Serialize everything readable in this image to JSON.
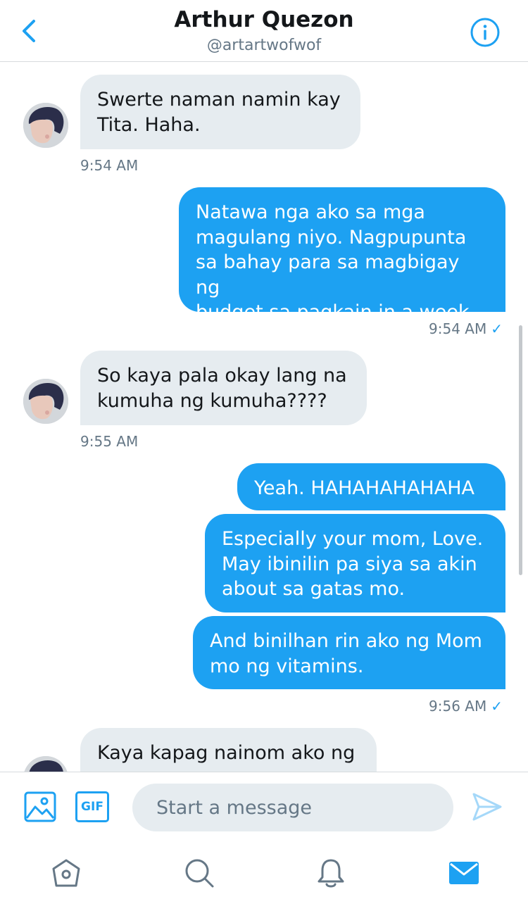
{
  "header": {
    "title": "Arthur Quezon",
    "handle": "@artartwofwof",
    "back_icon": "chevron-left-icon",
    "info_icon": "info-icon"
  },
  "colors": {
    "accent": "#1da1f2",
    "incoming_bubble": "#e6ecf0",
    "secondary_text": "#657786"
  },
  "messages": [
    {
      "direction": "incoming",
      "lines": [
        "Swerte naman namin kay",
        "Tita. Haha."
      ],
      "time": "9:54 AM"
    },
    {
      "direction": "outgoing",
      "lines": [
        "Natawa nga ako sa mga",
        "magulang niyo. Nagpupunta",
        "sa bahay para sa magbigay ng",
        "budget sa pagkain in a week."
      ],
      "time": "9:54 AM",
      "status": "✓"
    },
    {
      "direction": "incoming",
      "lines": [
        "So kaya pala okay lang na",
        "kumuha ng kumuha????"
      ],
      "time": "9:55 AM"
    },
    {
      "direction": "outgoing",
      "lines": [
        "Yeah. HAHAHAHAHAHA"
      ]
    },
    {
      "direction": "outgoing",
      "lines": [
        "Especially your mom, Love.",
        "May ibinilin pa siya sa akin",
        "about sa gatas mo."
      ]
    },
    {
      "direction": "outgoing",
      "lines": [
        "And binilhan rin ako ng Mom",
        "mo ng vitamins."
      ],
      "time": "9:56 AM",
      "status": "✓"
    },
    {
      "direction": "incoming",
      "lines": [
        "Kaya kapag nainom ako ng"
      ]
    }
  ],
  "composer": {
    "placeholder": "Start a message",
    "gif_label": "GIF",
    "media_icon": "image-icon",
    "send_icon": "send-icon"
  },
  "tabs": [
    {
      "name": "home-icon"
    },
    {
      "name": "search-icon"
    },
    {
      "name": "notifications-icon"
    },
    {
      "name": "messages-icon",
      "active": true
    }
  ]
}
